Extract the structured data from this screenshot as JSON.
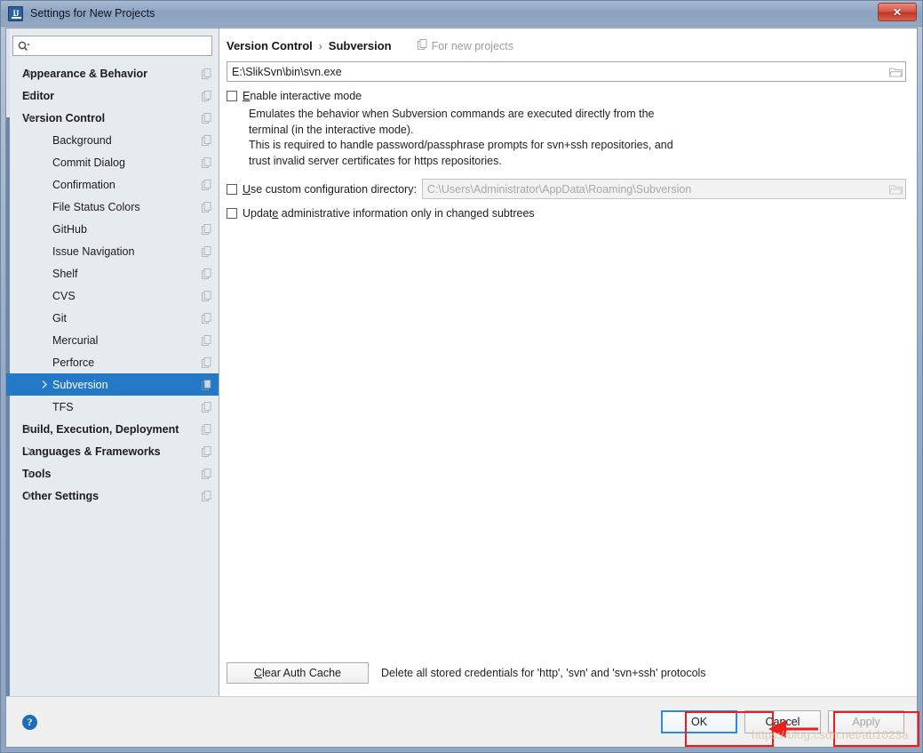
{
  "window": {
    "title": "Settings for New Projects",
    "app_icon": "intellij-idea-icon",
    "close_label": "✕"
  },
  "sidebar": {
    "search": {
      "value": "",
      "placeholder": ""
    },
    "items": [
      {
        "label": "Appearance & Behavior",
        "level": "top",
        "expanded": false,
        "arrow": "chevron-right",
        "selected": false
      },
      {
        "label": "Editor",
        "level": "top",
        "expanded": false,
        "arrow": "chevron-right",
        "selected": false
      },
      {
        "label": "Version Control",
        "level": "top",
        "expanded": true,
        "arrow": "chevron-down",
        "selected": false
      },
      {
        "label": "Background",
        "level": "child",
        "expanded": false,
        "arrow": "",
        "selected": false
      },
      {
        "label": "Commit Dialog",
        "level": "child",
        "expanded": false,
        "arrow": "",
        "selected": false
      },
      {
        "label": "Confirmation",
        "level": "child",
        "expanded": false,
        "arrow": "",
        "selected": false
      },
      {
        "label": "File Status Colors",
        "level": "child",
        "expanded": false,
        "arrow": "",
        "selected": false
      },
      {
        "label": "GitHub",
        "level": "child",
        "expanded": false,
        "arrow": "",
        "selected": false
      },
      {
        "label": "Issue Navigation",
        "level": "child",
        "expanded": false,
        "arrow": "",
        "selected": false
      },
      {
        "label": "Shelf",
        "level": "child",
        "expanded": false,
        "arrow": "",
        "selected": false
      },
      {
        "label": "CVS",
        "level": "child",
        "expanded": false,
        "arrow": "",
        "selected": false
      },
      {
        "label": "Git",
        "level": "child",
        "expanded": false,
        "arrow": "",
        "selected": false
      },
      {
        "label": "Mercurial",
        "level": "child",
        "expanded": false,
        "arrow": "",
        "selected": false
      },
      {
        "label": "Perforce",
        "level": "child",
        "expanded": false,
        "arrow": "",
        "selected": false
      },
      {
        "label": "Subversion",
        "level": "child",
        "expanded": false,
        "arrow": "chevron-right",
        "selected": true
      },
      {
        "label": "TFS",
        "level": "child",
        "expanded": false,
        "arrow": "",
        "selected": false
      },
      {
        "label": "Build, Execution, Deployment",
        "level": "top",
        "expanded": false,
        "arrow": "chevron-right",
        "selected": false
      },
      {
        "label": "Languages & Frameworks",
        "level": "top",
        "expanded": false,
        "arrow": "chevron-right",
        "selected": false
      },
      {
        "label": "Tools",
        "level": "top",
        "expanded": false,
        "arrow": "chevron-right",
        "selected": false
      },
      {
        "label": "Other Settings",
        "level": "top",
        "expanded": false,
        "arrow": "chevron-right",
        "selected": false
      }
    ]
  },
  "main": {
    "breadcrumb": {
      "parent": "Version Control",
      "separator": "›",
      "current": "Subversion"
    },
    "scope_label": "For new projects",
    "svn_path": {
      "value": "E:\\SlikSvn\\bin\\svn.exe",
      "browse_icon": "folder-open-icon"
    },
    "interactive_mode": {
      "label": "Enable interactive mode",
      "mnemonic": "E",
      "checked": false
    },
    "description_lines": [
      "Emulates the behavior when Subversion commands are executed directly from the",
      "terminal (in the interactive mode).",
      "This is required to handle password/passphrase prompts for svn+ssh repositories, and",
      "trust invalid server certificates for https repositories."
    ],
    "custom_config": {
      "label": "Use custom configuration directory:",
      "mnemonic": "U",
      "checked": false,
      "value": "C:\\Users\\Administrator\\AppData\\Roaming\\Subversion",
      "disabled": true,
      "browse_icon": "folder-open-icon"
    },
    "update_admin": {
      "label": "Update administrative information only in changed subtrees",
      "mnemonic": "e",
      "checked": false
    },
    "clear_auth": {
      "label": "Clear Auth Cache",
      "mnemonic": "C",
      "description": "Delete all stored credentials for 'http', 'svn' and 'svn+ssh' protocols"
    }
  },
  "footer": {
    "help_label": "?",
    "buttons": [
      {
        "label": "OK",
        "state": "default"
      },
      {
        "label": "Cancel",
        "state": "normal"
      },
      {
        "label": "Apply",
        "state": "disabled"
      }
    ]
  },
  "annotations": {
    "watermark": "https://blog.csdn.net/ab1023a",
    "highlight_color": "#ee1c1c",
    "boxes": [
      "ok-button-highlight",
      "apply-button-highlight"
    ],
    "arrow": "cancel-pointer-arrow"
  },
  "colors": {
    "accent": "#2478c8",
    "titlebar": "#8ba2c0",
    "close_button": "#bf3525",
    "highlight": "#ee1c1c"
  }
}
